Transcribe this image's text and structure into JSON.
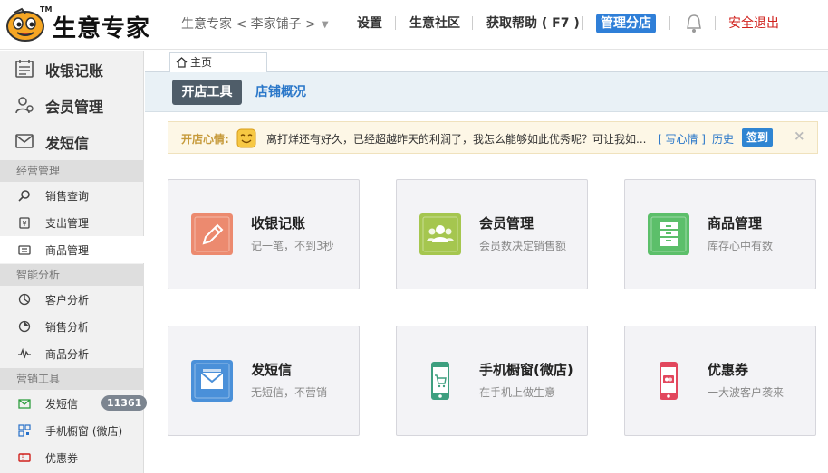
{
  "header": {
    "logo_text": "生意专家",
    "logo_tm": "TM",
    "store_label": "生意专家 < 李家铺子 >",
    "nav": [
      "设置",
      "生意社区",
      "获取帮助 ( F7 )"
    ],
    "manage_button": "管理分店",
    "logout": "安全退出",
    "accent_color": "#2f7fd8",
    "logout_color": "#d0211c"
  },
  "sidebar": {
    "main_items": [
      {
        "label": "收银记账",
        "icon": "register-list-icon"
      },
      {
        "label": "会员管理",
        "icon": "member-icon"
      },
      {
        "label": "发短信",
        "icon": "envelope-icon"
      }
    ],
    "sections": [
      {
        "title": "经营管理",
        "items": [
          {
            "label": "销售查询",
            "icon": "search-icon"
          },
          {
            "label": "支出管理",
            "icon": "expense-icon"
          },
          {
            "label": "商品管理",
            "icon": "goods-icon",
            "active": true
          }
        ]
      },
      {
        "title": "智能分析",
        "items": [
          {
            "label": "客户分析",
            "icon": "customer-chart-icon"
          },
          {
            "label": "销售分析",
            "icon": "pie-chart-icon"
          },
          {
            "label": "商品分析",
            "icon": "wave-chart-icon"
          }
        ]
      },
      {
        "title": "营销工具",
        "items": [
          {
            "label": "发短信",
            "icon": "sms-icon",
            "badge": "11361"
          },
          {
            "label": "手机橱窗 (微店)",
            "icon": "qrcode-icon"
          },
          {
            "label": "优惠券",
            "icon": "coupon-icon"
          }
        ]
      }
    ]
  },
  "tabs": {
    "home": "主页"
  },
  "subnav": {
    "active": "开店工具",
    "other": "店铺概况"
  },
  "notice": {
    "title": "开店心情:",
    "message": "离打烊还有好久，已经超越昨天的利润了，我怎么能够如此优秀呢？可让我如...",
    "write_link": "[ 写心情 ]",
    "history_link": "历史",
    "sign_button": "签到",
    "close": "×"
  },
  "cards": [
    {
      "title": "收银记账",
      "sub": "记一笔，不到3秒",
      "icon": "pencil-icon",
      "color": "#ec8a6f"
    },
    {
      "title": "会员管理",
      "sub": "会员数决定销售额",
      "icon": "members-icon",
      "color": "#a5c64f"
    },
    {
      "title": "商品管理",
      "sub": "库存心中有数",
      "icon": "cabinet-icon",
      "color": "#5cbf6a"
    },
    {
      "title": "发短信",
      "sub": "无短信，不营销",
      "icon": "mail-icon",
      "color": "#4a90d9"
    },
    {
      "title": "手机橱窗(微店)",
      "sub": "在手机上做生意",
      "icon": "phone-cart-icon",
      "color": "#3d9f7f"
    },
    {
      "title": "优惠券",
      "sub": "一大波客户袭来",
      "icon": "phone-coupon-icon",
      "color": "#e2475d"
    }
  ]
}
